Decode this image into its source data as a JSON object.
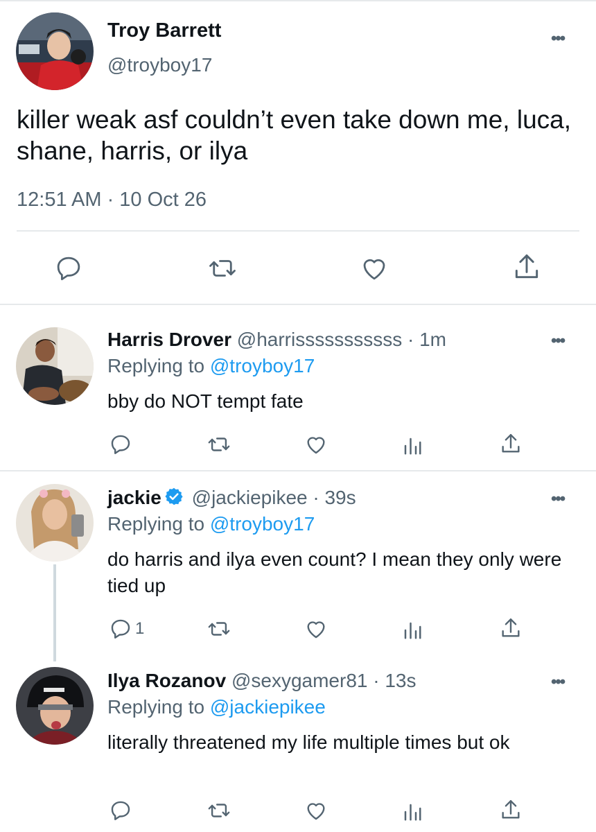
{
  "main_tweet": {
    "name": "Troy Barrett",
    "handle": "@troyboy17",
    "text": "killer weak asf couldn’t even take down me, luca, shane, harris, or ilya",
    "time": "12:51 AM · 10 Oct 26"
  },
  "replies": [
    {
      "name": "Harris Drover",
      "handle": "@harrisssssssssss · 1m",
      "replying_prefix": "Replying to ",
      "replying_to": "@troyboy17",
      "text": "bby do NOT tempt fate",
      "reply_count": ""
    },
    {
      "name": "jackie",
      "handle": "@jackiepikee · 39s",
      "replying_prefix": "Replying to ",
      "replying_to": "@troyboy17",
      "text": "do harris and ilya even count? I mean they only were tied up",
      "reply_count": "1",
      "verified": true
    },
    {
      "name": "Ilya Rozanov",
      "handle": "@sexygamer81 · 13s",
      "replying_prefix": "Replying to ",
      "replying_to": "@jackiepikee",
      "text": "literally threatened my life multiple times but ok",
      "reply_count": ""
    }
  ],
  "icons": {
    "more": "more-icon",
    "reply": "reply-icon",
    "retweet": "retweet-icon",
    "like": "like-icon",
    "views": "views-icon",
    "share": "share-icon",
    "verified": "verified-badge-icon"
  },
  "colors": {
    "text": "#0f1419",
    "secondary": "#536471",
    "link": "#1d9bf0",
    "divider": "#e6e9eb"
  }
}
